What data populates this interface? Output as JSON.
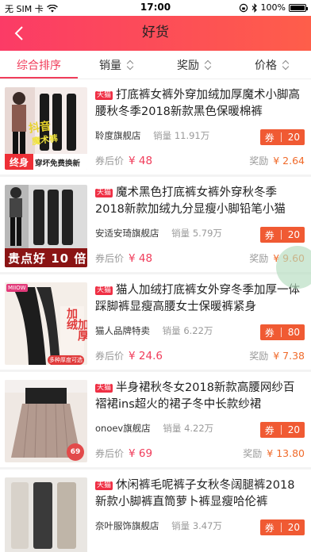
{
  "status_bar": {
    "carrier": "无 SIM 卡",
    "time": "17:00",
    "battery": "100%",
    "battery_level": 1.0,
    "icons": [
      "wifi-icon",
      "lock-rotation-icon",
      "bluetooth-icon",
      "battery-icon"
    ]
  },
  "nav": {
    "title": "好货",
    "back_icon": "chevron-left-icon",
    "gradient_start": "#fb3b66",
    "gradient_end": "#fe5e4a"
  },
  "tabs": [
    {
      "label": "综合排序",
      "active": true
    },
    {
      "label": "销量",
      "active": false
    },
    {
      "label": "奖励",
      "active": false
    },
    {
      "label": "价格",
      "active": false
    }
  ],
  "labels": {
    "after_coupon": "券后价",
    "reward": "奖励",
    "coupon": "券",
    "sales_prefix": "销量"
  },
  "products": [
    {
      "badge": "天猫",
      "title": "打底裤女裤外穿加绒加厚魔术小脚高腰秋冬季2018新款黑色保暖棉裤",
      "shop": "聆度旗舰店",
      "sales": "11.91万",
      "coupon": "20",
      "price": "¥ 48",
      "reward": "¥ 2.64",
      "thumb_text": [
        "抖音",
        "魔术裤",
        "终身",
        "穿坏免费换新"
      ]
    },
    {
      "badge": "天猫",
      "title": "魔术黑色打底裤女裤外穿秋冬季2018新款加绒九分显瘦小脚铅笔小猫",
      "shop": "安适安琦旗舰店",
      "sales": "5.79万",
      "coupon": "20",
      "price": "¥ 48",
      "reward": "¥ 9.60",
      "thumb_text": [
        "贵点好 10 倍"
      ]
    },
    {
      "badge": "天猫",
      "title": "猫人加绒打底裤女外穿冬季加厚一体踩脚裤显瘦高腰女士保暖裤紧身",
      "shop": "猫人品牌特卖",
      "sales": "6.22万",
      "coupon": "80",
      "price": "¥ 24.6",
      "reward": "¥ 7.38",
      "thumb_text": [
        "MIIOW",
        "加绒",
        "加厚",
        "多种厚度可选"
      ]
    },
    {
      "badge": "天猫",
      "title": "半身裙秋冬女2018新款高腰网纱百褶裙ins超火的裙子冬中长款纱裙",
      "shop": "onoev旗舰店",
      "sales": "4.22万",
      "coupon": "20",
      "price": "¥ 69",
      "reward": "¥ 13.80",
      "thumb_text": [
        "69"
      ]
    },
    {
      "badge": "天猫",
      "title": "休闲裤毛呢裤子女秋冬阔腿裤2018新款小脚裤直筒萝卜裤显瘦哈伦裤",
      "shop": "奈叶服饰旗舰店",
      "sales": "3.47万",
      "coupon": "20",
      "price": "",
      "reward": "",
      "thumb_text": []
    }
  ]
}
